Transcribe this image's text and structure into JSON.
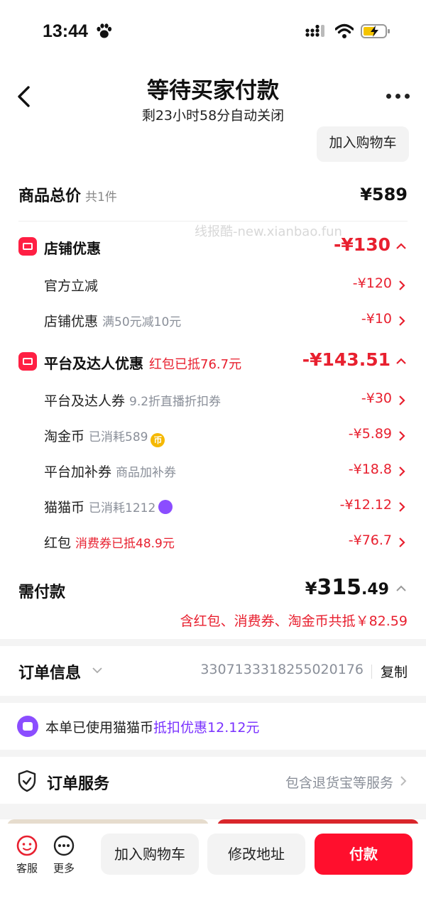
{
  "status_bar": {
    "time": "13:44"
  },
  "header": {
    "title": "等待买家付款",
    "subtitle": "剩23小时58分自动关闭",
    "add_cart_top": "加入购物车"
  },
  "goods_total": {
    "label": "商品总价",
    "count": "共1件",
    "amount": "¥589"
  },
  "watermark": "线报酷-new.xianbao.fun",
  "store_discount": {
    "label": "店铺优惠",
    "amount": "-¥130",
    "items": [
      {
        "name": "官方立减",
        "sub": "",
        "amount": "-¥120"
      },
      {
        "name": "店铺优惠",
        "sub": "满50元减10元",
        "amount": "-¥10"
      }
    ]
  },
  "platform_discount": {
    "label": "平台及达人优惠",
    "tag": "红包已抵76.7元",
    "amount": "-¥143.51",
    "items": [
      {
        "name": "平台及达人券",
        "sub": "9.2折直播折扣券",
        "amount": "-¥30"
      },
      {
        "name": "淘金币",
        "sub": "已消耗589",
        "amount": "-¥5.89"
      },
      {
        "name": "平台加补券",
        "sub": "商品加补券",
        "amount": "-¥18.8"
      },
      {
        "name": "猫猫币",
        "sub": "已消耗1212",
        "amount": "-¥12.12"
      },
      {
        "name": "红包",
        "sub": "消费券已抵48.9元",
        "amount": "-¥76.7"
      }
    ]
  },
  "payment": {
    "label": "需付款",
    "currency": "¥",
    "integer": "315",
    "decimal": ".49",
    "note": "含红包、消费券、淘金币共抵￥82.59"
  },
  "order_info": {
    "label": "订单信息",
    "number": "3307133318255020176",
    "copy": "复制"
  },
  "catcoin_notice": {
    "prefix": "本单已使用猫猫币",
    "highlight": "抵扣优惠12.12元"
  },
  "order_service": {
    "label": "订单服务",
    "right": "包含退货宝等服务"
  },
  "bottom_bar": {
    "service": "客服",
    "more": "更多",
    "add_cart": "加入购物车",
    "modify_address": "修改地址",
    "pay": "付款"
  },
  "colors": {
    "accent_red": "#e8202f",
    "pay_button": "#ff0f2d",
    "catcoin_purple": "#8b4dff"
  }
}
